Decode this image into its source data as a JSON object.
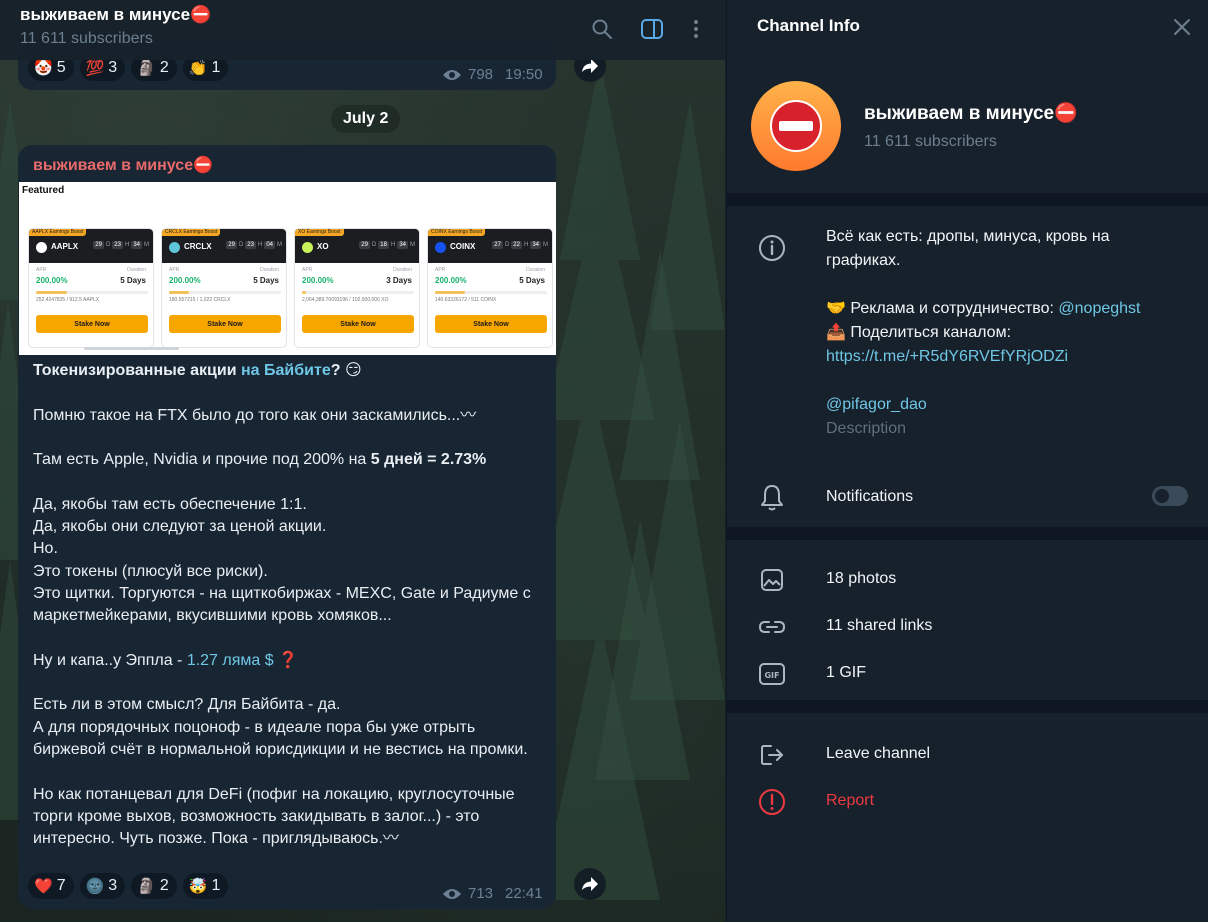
{
  "chat": {
    "title": "выживаем в минусе⛔",
    "subtitle": "11 611 subscribers",
    "header_icons": [
      "search-icon",
      "sidebar-toggle-icon",
      "more-vertical-icon"
    ]
  },
  "previous_message": {
    "reactions": [
      {
        "emoji": "🤡",
        "count": "5"
      },
      {
        "emoji": "💯",
        "count": "3"
      },
      {
        "emoji": "🗿",
        "count": "2"
      },
      {
        "emoji": "👏",
        "count": "1"
      }
    ],
    "views": "798",
    "time": "19:50"
  },
  "date_separator": "July 2",
  "message": {
    "author": "выживаем в минусе⛔",
    "image": {
      "featured_label": "Featured",
      "cards": [
        {
          "tag": "AAPLX Earnings Boost",
          "name": "AAPLX",
          "d": "29",
          "h": "23",
          "m": "34",
          "apr_label": "APR",
          "apr": "200.00%",
          "dur_label": "Duration",
          "duration": "5 Days",
          "supply": "252.4247835 / 912.5 AAPLX",
          "button": "Stake Now"
        },
        {
          "tag": "CRCLX Earnings Boost",
          "name": "CRCLX",
          "d": "29",
          "h": "23",
          "m": "04",
          "apr_label": "APR",
          "apr": "200.00%",
          "dur_label": "Duration",
          "duration": "5 Days",
          "supply": "180.557215 / 1,022 CRCLX",
          "button": "Stake Now"
        },
        {
          "tag": "XO Earnings Boost",
          "name": "XO",
          "d": "29",
          "h": "18",
          "m": "34",
          "apr_label": "APR",
          "apr": "200.00%",
          "dur_label": "Duration",
          "duration": "3 Days",
          "supply": "2,064,389.70093196 / 102,500,000 XO",
          "button": "Stake Now"
        },
        {
          "tag": "COINX Earnings Boost",
          "name": "COINX",
          "d": "27",
          "h": "22",
          "m": "34",
          "apr_label": "APR",
          "apr": "200.00%",
          "dur_label": "Duration",
          "duration": "5 Days",
          "supply": "140.63326172 / 511 COINX",
          "button": "Stake Now"
        }
      ],
      "d_unit": "D",
      "h_unit": "H",
      "m_unit": "M"
    },
    "line1_bold": "Токенизированные акции",
    "line1_link": "на Байбите",
    "line1_tail": "? 😏",
    "p2": "Помню такое на FTX было до того как они заскамились...〰",
    "p3_a": "Там есть Apple, Nvidia и прочие под 200% на ",
    "p3_b": "5 дней = 2.73%",
    "p4": [
      "Да, якобы там есть обеспечение 1:1.",
      "Да, якобы они следуют за ценой акции.",
      "Но.",
      "Это токены (плюсуй все риски).",
      "Это щитки. Торгуются - на щиткобиржах - MEXC, Gate и Радиуме с маркетмейкерами, вкусившими кровь хомяков..."
    ],
    "p5_a": "Ну и капа..у Эппла - ",
    "p5_link": "1.27 ляма $",
    "p5_tail": " ❓",
    "p6": [
      "Есть ли в этом смысл? Для Байбита - да.",
      "А для порядочных поцоноф - в идеале пора бы уже отрыть биржевой счёт в нормальной юрисдикции и не вестись на промки."
    ],
    "p7": "Но как потанцевал для DeFi (пофиг на локацию, круглосуточные торги кроме выхов, возможность закидывать в залог...) - это интересно. Чуть позже. Пока - приглядываюсь.〰",
    "reactions": [
      {
        "emoji": "❤️",
        "count": "7"
      },
      {
        "emoji": "🌚",
        "count": "3"
      },
      {
        "emoji": "🗿",
        "count": "2"
      },
      {
        "emoji": "🤯",
        "count": "1"
      }
    ],
    "views": "713",
    "time": "22:41"
  },
  "panel": {
    "title": "Channel Info",
    "channel_name": "выживаем в минусе⛔",
    "subscribers": "11 611 subscribers",
    "description_lines": [
      "Всё как есть: дропы, минуса, кровь на графиках."
    ],
    "ad_prefix": "🤝 Реклама и сотрудничество: ",
    "ad_handle": "@nopeghst",
    "share_label": "📤 Поделиться каналом:",
    "share_link": "https://t.me/+R5dY6RVEfYRjODZi",
    "handle": "@pifagor_dao",
    "description_label": "Description",
    "notifications": "Notifications",
    "notifications_on": false,
    "photos": "18 photos",
    "links": "11 shared links",
    "gifs": "1 GIF",
    "leave": "Leave channel",
    "report": "Report"
  },
  "colors": {
    "accent_link": "#6fc7e6",
    "author": "#e86a6a",
    "danger": "#ec3942",
    "panel_bg": "#17212b",
    "bubble_bg": "#182533"
  }
}
